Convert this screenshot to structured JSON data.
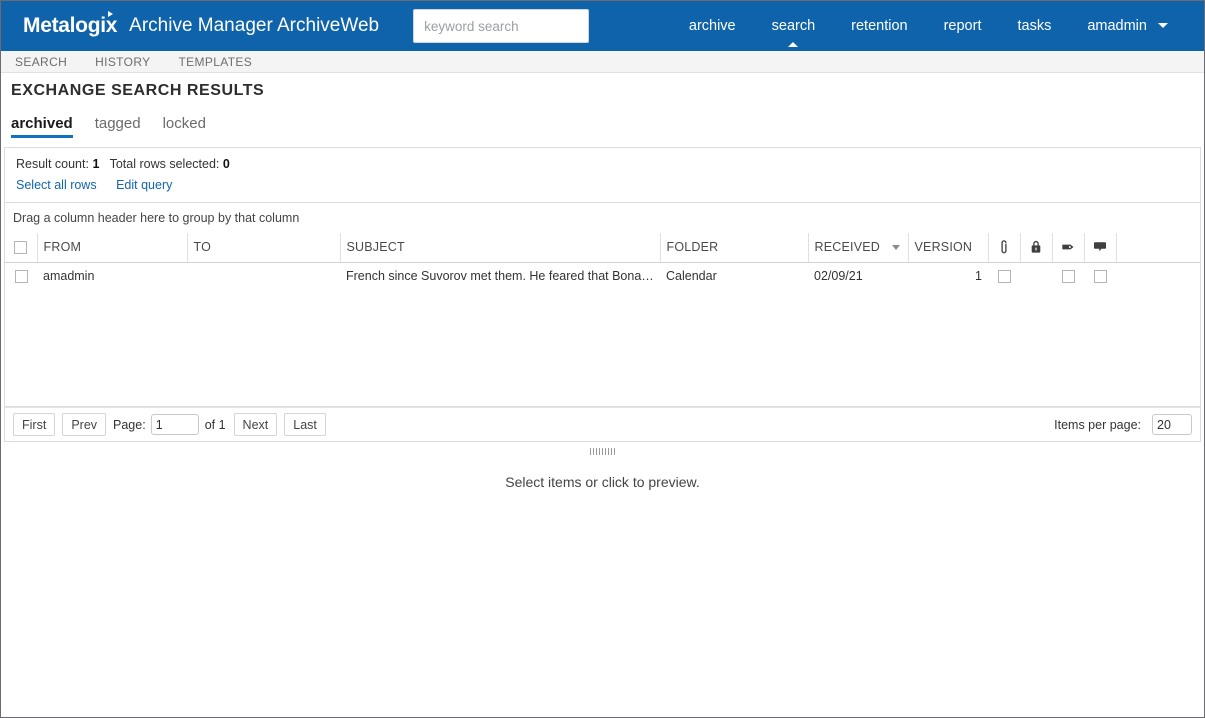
{
  "header": {
    "logo": "Metalogix",
    "app_title": "Archive Manager ArchiveWeb",
    "search_placeholder": "keyword search",
    "search_value": "",
    "brand_color": "#0f63ab",
    "nav": [
      {
        "label": "archive",
        "active": false
      },
      {
        "label": "search",
        "active": true
      },
      {
        "label": "retention",
        "active": false
      },
      {
        "label": "report",
        "active": false
      },
      {
        "label": "tasks",
        "active": false
      }
    ],
    "user_menu": {
      "label": "amadmin",
      "icon": "chevron-down-icon"
    }
  },
  "subnav": {
    "items": [
      {
        "label": "SEARCH"
      },
      {
        "label": "HISTORY"
      },
      {
        "label": "TEMPLATES"
      }
    ]
  },
  "page": {
    "title": "EXCHANGE SEARCH RESULTS",
    "accent_color": "#1272bd"
  },
  "tabs": [
    {
      "label": "archived",
      "active": true
    },
    {
      "label": "tagged",
      "active": false
    },
    {
      "label": "locked",
      "active": false
    }
  ],
  "result_info": {
    "result_count_label": "Result count:",
    "result_count_value": "1",
    "selected_label": "Total rows selected:",
    "selected_value": "0",
    "links": [
      {
        "label": "Select all rows"
      },
      {
        "label": "Edit query"
      }
    ]
  },
  "group_bar": {
    "text": "Drag a column header here to group by that column"
  },
  "grid": {
    "columns": [
      {
        "key": "checkbox",
        "label": "",
        "icon": "checkbox-icon",
        "type": "checkbox"
      },
      {
        "key": "from",
        "label": "FROM",
        "type": "text"
      },
      {
        "key": "to",
        "label": "TO",
        "type": "text"
      },
      {
        "key": "subject",
        "label": "SUBJECT",
        "type": "text"
      },
      {
        "key": "folder",
        "label": "FOLDER",
        "type": "text"
      },
      {
        "key": "received",
        "label": "RECEIVED",
        "type": "text",
        "sort": "desc",
        "sort_icon": "caret-down-icon"
      },
      {
        "key": "version",
        "label": "VERSION",
        "type": "number"
      },
      {
        "key": "attachment",
        "label": "",
        "icon": "paperclip-icon",
        "type": "icon"
      },
      {
        "key": "locked",
        "label": "",
        "icon": "lock-icon",
        "type": "icon"
      },
      {
        "key": "tagged",
        "label": "",
        "icon": "tag-icon",
        "type": "icon"
      },
      {
        "key": "note",
        "label": "",
        "icon": "speech-bubble-icon",
        "type": "icon"
      },
      {
        "key": "filler",
        "label": "",
        "type": "text"
      }
    ],
    "rows": [
      {
        "selected": false,
        "from": "amadmin",
        "to": "",
        "subject": "French since Suvorov met them. He feared that Bonapart...",
        "folder": "Calendar",
        "received": "02/09/21",
        "version": "1",
        "attachment": false,
        "locked": null,
        "tagged": false,
        "note": false
      }
    ]
  },
  "pager": {
    "first_label": "First",
    "prev_label": "Prev",
    "page_label": "Page:",
    "page_value": "1",
    "of_label": "of 1",
    "next_label": "Next",
    "last_label": "Last",
    "items_per_page_label": "Items per page:",
    "items_per_page_value": "20"
  },
  "preview": {
    "splitter_icon": "grip-handle-icon",
    "message": "Select items or click to preview."
  }
}
